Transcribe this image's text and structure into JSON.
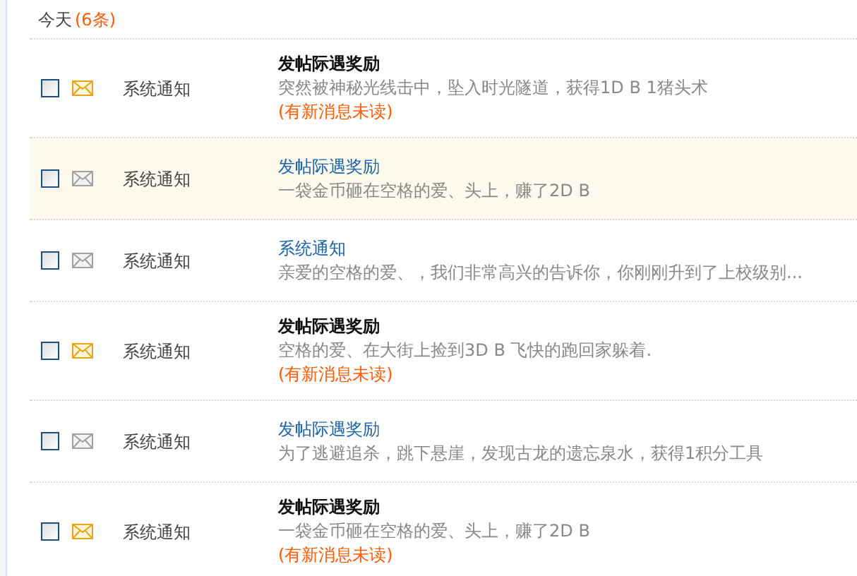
{
  "group": {
    "label": "今天",
    "count": "(6条)"
  },
  "messages": [
    {
      "checked": false,
      "unread": true,
      "highlighted": false,
      "sender": "系统通知",
      "title": "发帖际遇奖励",
      "body": "突然被神秘光线击中，坠入时光隧道，获得1D B 1猪头术",
      "note": "(有新消息未读)"
    },
    {
      "checked": false,
      "unread": false,
      "highlighted": true,
      "sender": "系统通知",
      "title": "发帖际遇奖励",
      "body": "一袋金币砸在空格的爱、头上，赚了2D B"
    },
    {
      "checked": false,
      "unread": false,
      "highlighted": false,
      "sender": "系统通知",
      "title": "系统通知",
      "body": "亲爱的空格的爱、，我们非常高兴的告诉你，你刚刚升到了上校级别..."
    },
    {
      "checked": false,
      "unread": true,
      "highlighted": false,
      "sender": "系统通知",
      "title": "发帖际遇奖励",
      "body": "空格的爱、在大街上捡到3D B  飞快的跑回家躲着.",
      "note": "(有新消息未读)"
    },
    {
      "checked": false,
      "unread": false,
      "highlighted": false,
      "sender": "系统通知",
      "title": "发帖际遇奖励",
      "body": "为了逃避追杀，跳下悬崖，发现古龙的遗忘泉水，获得1积分工具"
    },
    {
      "checked": false,
      "unread": true,
      "highlighted": false,
      "sender": "系统通知",
      "title": "发帖际遇奖励",
      "body": "一袋金币砸在空格的爱、头上，赚了2D B",
      "note": "(有新消息未读)"
    }
  ]
}
